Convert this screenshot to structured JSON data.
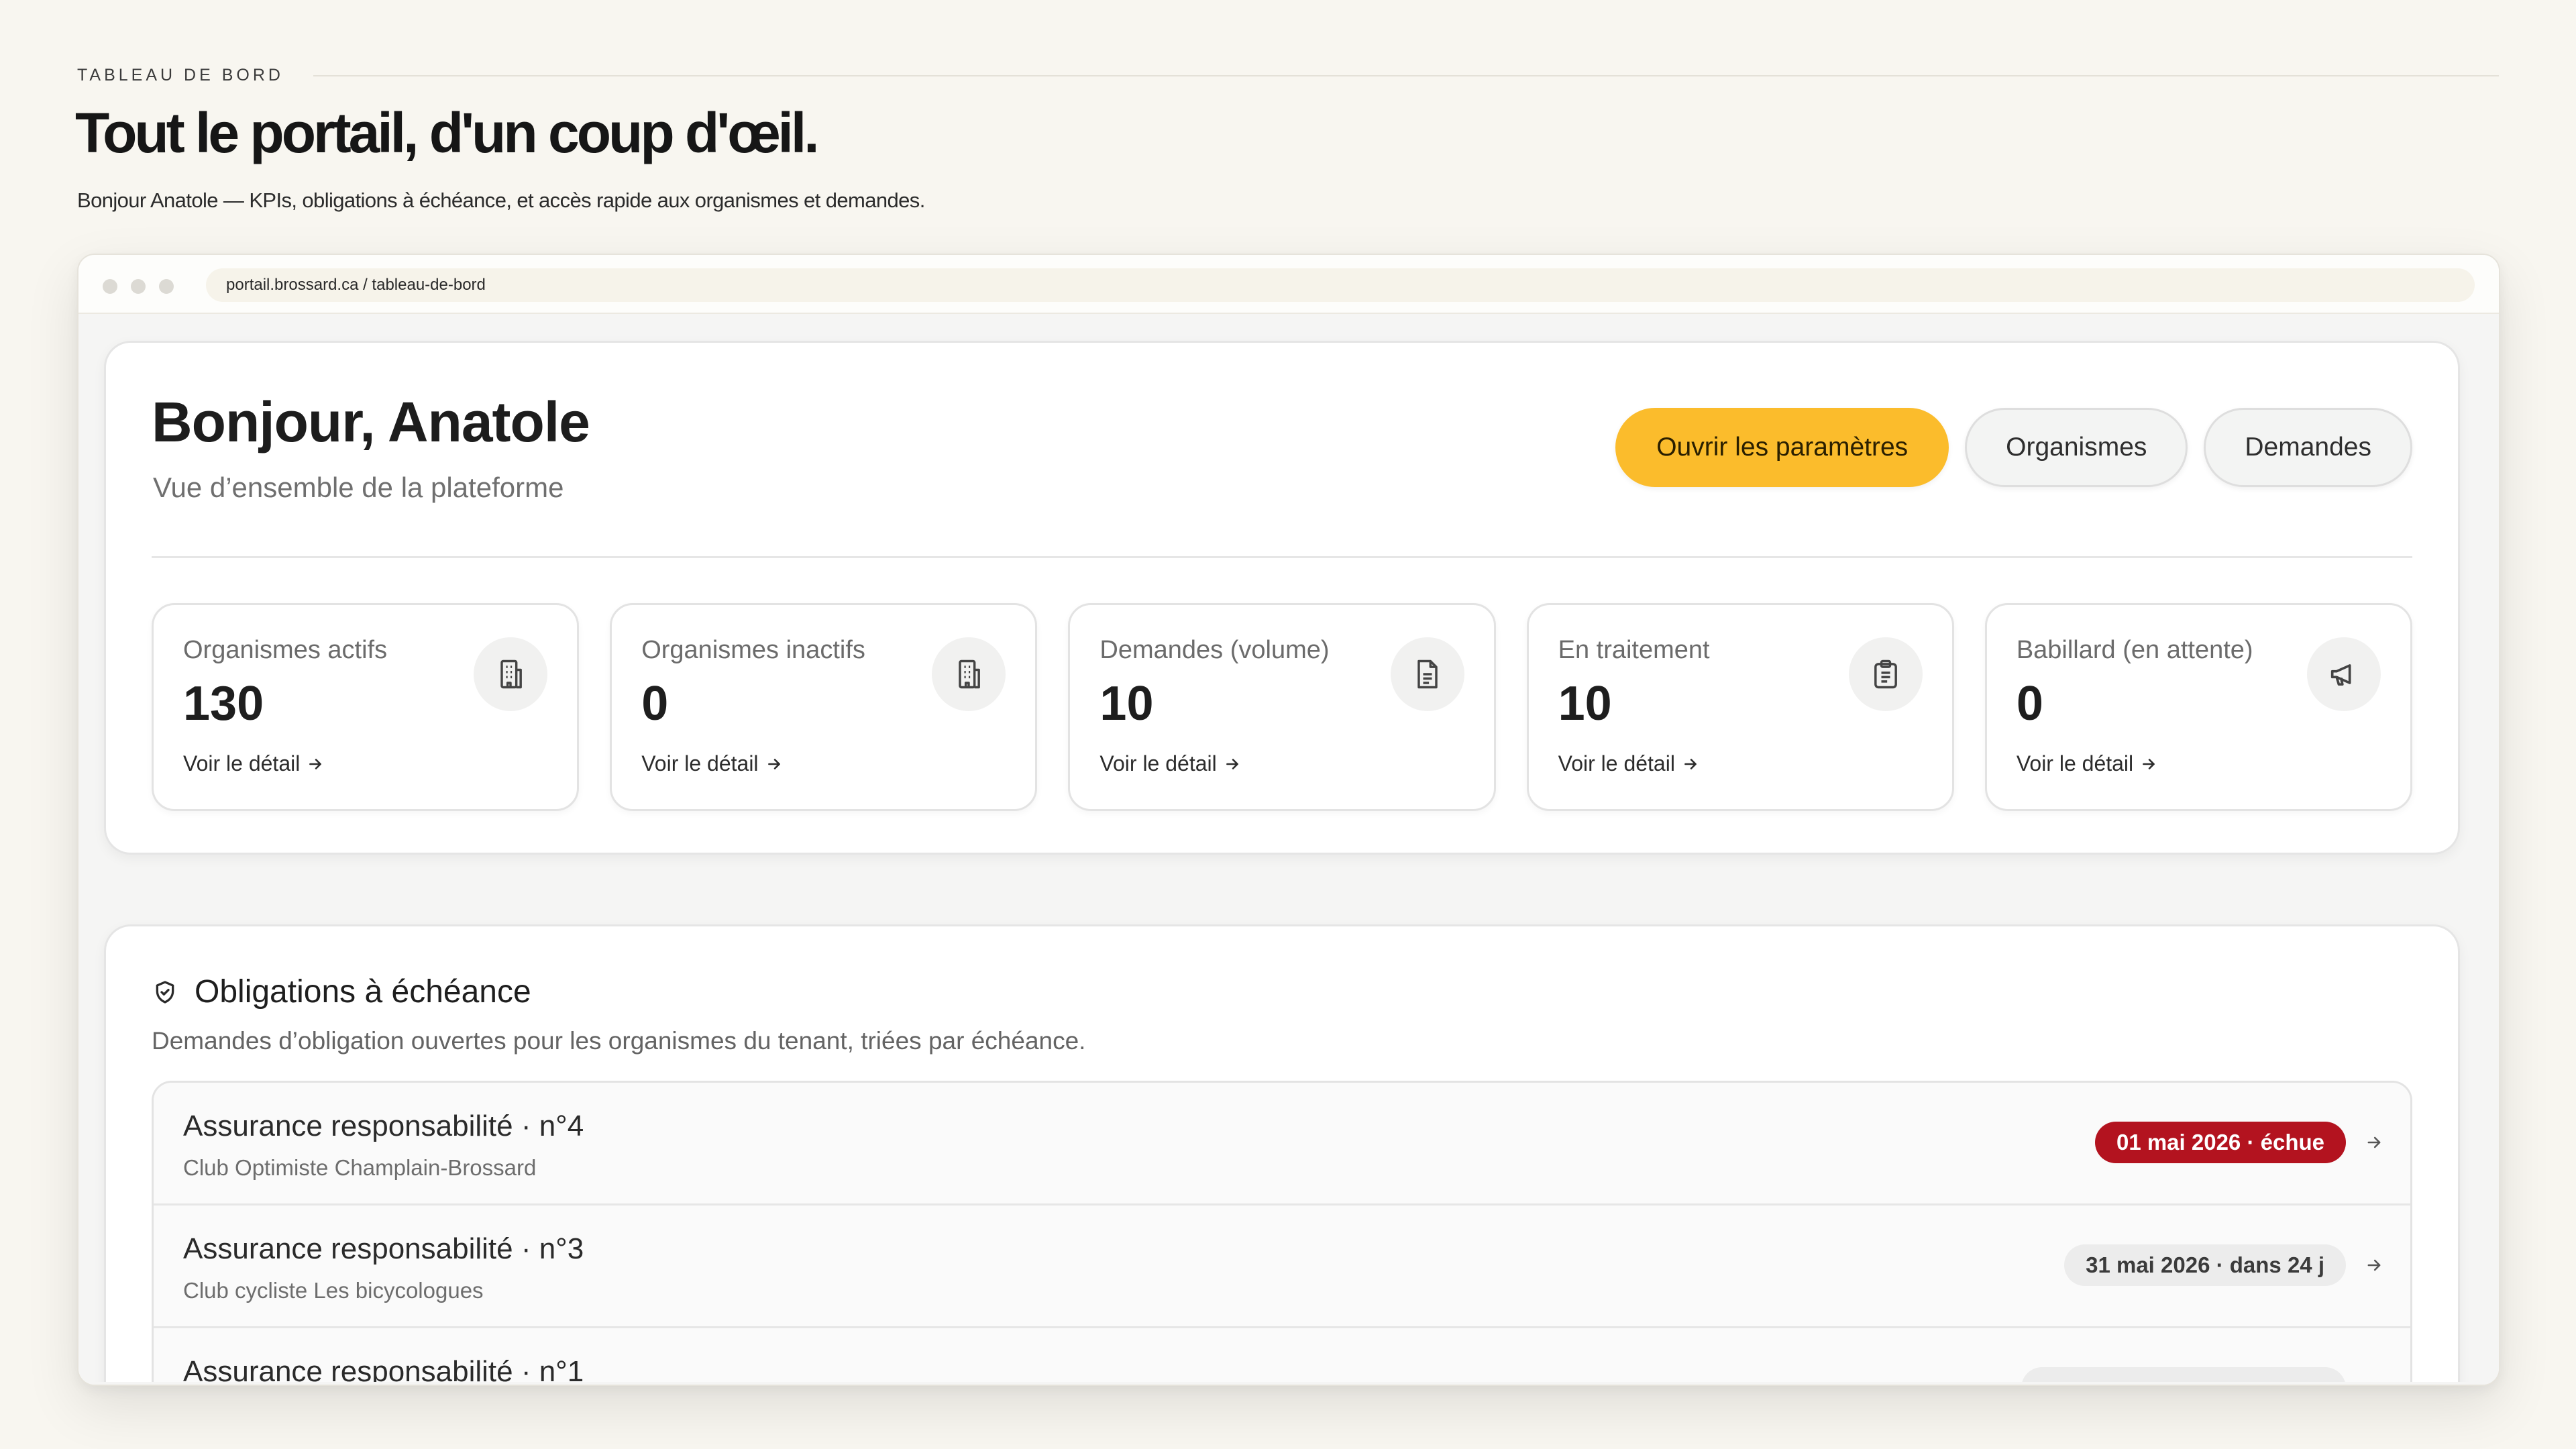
{
  "page": {
    "eyebrow": "TABLEAU DE BORD",
    "title": "Tout le portail, d'un coup d'œil.",
    "subtitle": "Bonjour Anatole — KPIs, obligations à échéance, et accès rapide aux organismes et demandes."
  },
  "browser": {
    "url": "portail.brossard.ca / tableau-de-bord"
  },
  "hero": {
    "greeting": "Bonjour, Anatole",
    "tagline": "Vue d’ensemble de la plateforme",
    "actions": {
      "settings": "Ouvrir les paramètres",
      "organismes": "Organismes",
      "demandes": "Demandes"
    }
  },
  "kpis": [
    {
      "label": "Organismes actifs",
      "value": "130",
      "link": "Voir le détail",
      "icon": "building-icon"
    },
    {
      "label": "Organismes inactifs",
      "value": "0",
      "link": "Voir le détail",
      "icon": "building-icon"
    },
    {
      "label": "Demandes (volume)",
      "value": "10",
      "link": "Voir le détail",
      "icon": "document-icon"
    },
    {
      "label": "En traitement",
      "value": "10",
      "link": "Voir le détail",
      "icon": "clipboard-icon"
    },
    {
      "label": "Babillard (en attente)",
      "value": "0",
      "link": "Voir le détail",
      "icon": "megaphone-icon"
    }
  ],
  "obligations": {
    "title": "Obligations à échéance",
    "description": "Demandes d’obligation ouvertes pour les organismes du tenant, triées par échéance.",
    "rows": [
      {
        "title": "Assurance responsabilité · n°4",
        "organisme": "Club Optimiste Champlain-Brossard",
        "due": "01 mai 2026 · échue",
        "status": "overdue"
      },
      {
        "title": "Assurance responsabilité · n°3",
        "organisme": "Club cycliste Les bicycologues",
        "due": "31 mai 2026 · dans 24 j",
        "status": "upcoming"
      },
      {
        "title": "Assurance responsabilité · n°1",
        "organisme": "",
        "due": "",
        "status": "upcoming"
      }
    ]
  },
  "colors": {
    "primary_button": "#fbbc2c",
    "overdue_badge": "#b3131f",
    "page_background": "#f8f6f0"
  }
}
